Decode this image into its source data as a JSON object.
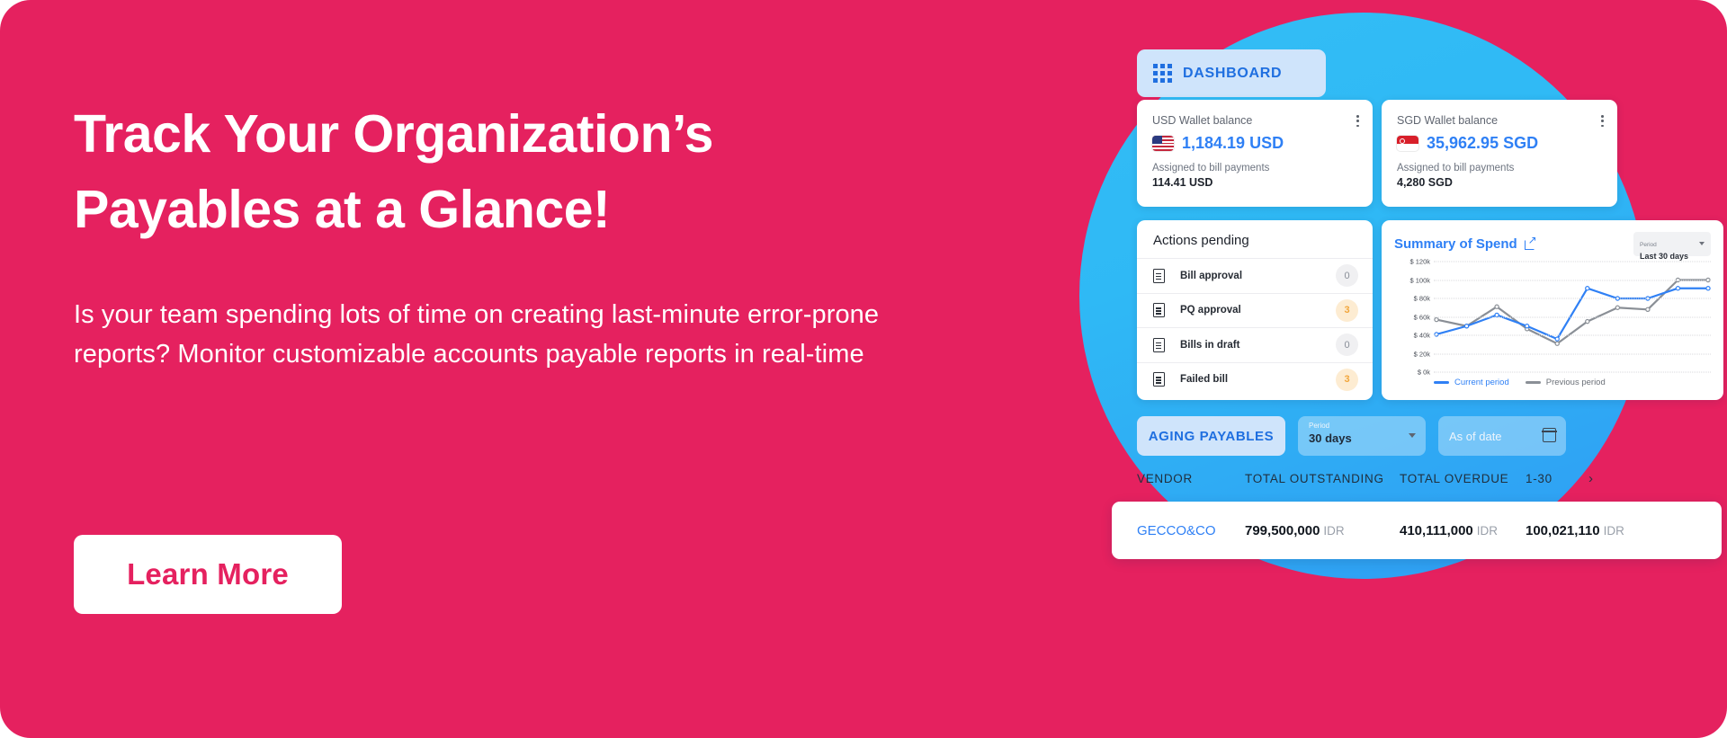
{
  "banner": {
    "headline": "Track Your Organization’s Payables at a Glance!",
    "subcopy": "Is your team spending lots of time on creating last-minute error-prone reports? Monitor customizable accounts payable reports in real-time",
    "cta_label": "Learn More",
    "background_color": "#e5215f",
    "accent_color": "#2f80f5"
  },
  "dashboard": {
    "nav_pill_label": "DASHBOARD",
    "nav_icon": "grid-icon",
    "wallets": [
      {
        "title": "USD Wallet balance",
        "flag": "us-flag-icon",
        "amount": "1,184.19 USD",
        "sub_label": "Assigned to bill payments",
        "sub_value": "114.41 USD",
        "menu_icon": "kebab-menu-icon"
      },
      {
        "title": "SGD Wallet balance",
        "flag": "sg-flag-icon",
        "amount": "35,962.95 SGD",
        "sub_label": "Assigned to bill payments",
        "sub_value": "4,280 SGD",
        "menu_icon": "kebab-menu-icon"
      }
    ],
    "actions_pending": {
      "title": "Actions pending",
      "rows": [
        {
          "icon": "document-icon",
          "label": "Bill approval",
          "count": "0",
          "state": "zero"
        },
        {
          "icon": "document-icon",
          "label": "PQ approval",
          "count": "3",
          "state": "warn"
        },
        {
          "icon": "document-icon",
          "label": "Bills in draft",
          "count": "0",
          "state": "zero"
        },
        {
          "icon": "document-icon",
          "label": "Failed bill",
          "count": "3",
          "state": "warn"
        }
      ]
    },
    "summary_of_spend": {
      "title": "Summary of Spend",
      "external_link_icon": "external-link-icon",
      "period_label": "Period",
      "period_value": "Last 30 days",
      "dropdown_icon": "chevron-down-icon"
    },
    "aging_payables": {
      "pill_label": "AGING PAYABLES",
      "period_label": "Period",
      "period_value": "30 days",
      "as_of_date_placeholder": "As of date",
      "calendar_icon": "calendar-icon",
      "dropdown_icon": "chevron-down-icon",
      "columns": [
        "VENDOR",
        "TOTAL OUTSTANDING",
        "TOTAL OVERDUE",
        "1-30"
      ],
      "next_icon": "chevron-right-icon",
      "rows": [
        {
          "vendor": "GECCO&CO",
          "total_outstanding": "799,500,000",
          "total_outstanding_currency": "IDR",
          "total_overdue": "410,111,000",
          "total_overdue_currency": "IDR",
          "bucket_1_30": "100,021,110",
          "bucket_1_30_currency": "IDR"
        }
      ]
    }
  },
  "chart_data": {
    "type": "line",
    "title": "Summary of Spend",
    "xlabel": "",
    "ylabel": "",
    "ylim": [
      0,
      120000
    ],
    "yticks": [
      0,
      20000,
      40000,
      60000,
      80000,
      100000,
      120000
    ],
    "ytick_labels": [
      "$ 0k",
      "$ 20k",
      "$ 40k",
      "$ 60k",
      "$ 80k",
      "$ 100k",
      "$ 120k"
    ],
    "grid": true,
    "legend_position": "bottom-left",
    "x": [
      1,
      2,
      3,
      4,
      5,
      6,
      7,
      8,
      9,
      10
    ],
    "series": [
      {
        "name": "Current period",
        "color": "#2f80f5",
        "values": [
          41000,
          50000,
          62000,
          50000,
          36000,
          91000,
          80000,
          80000,
          91000,
          91000
        ]
      },
      {
        "name": "Previous period",
        "color": "#8a8f96",
        "values": [
          57000,
          50000,
          71000,
          47000,
          31000,
          55000,
          70000,
          68000,
          100000,
          100000
        ]
      }
    ]
  }
}
